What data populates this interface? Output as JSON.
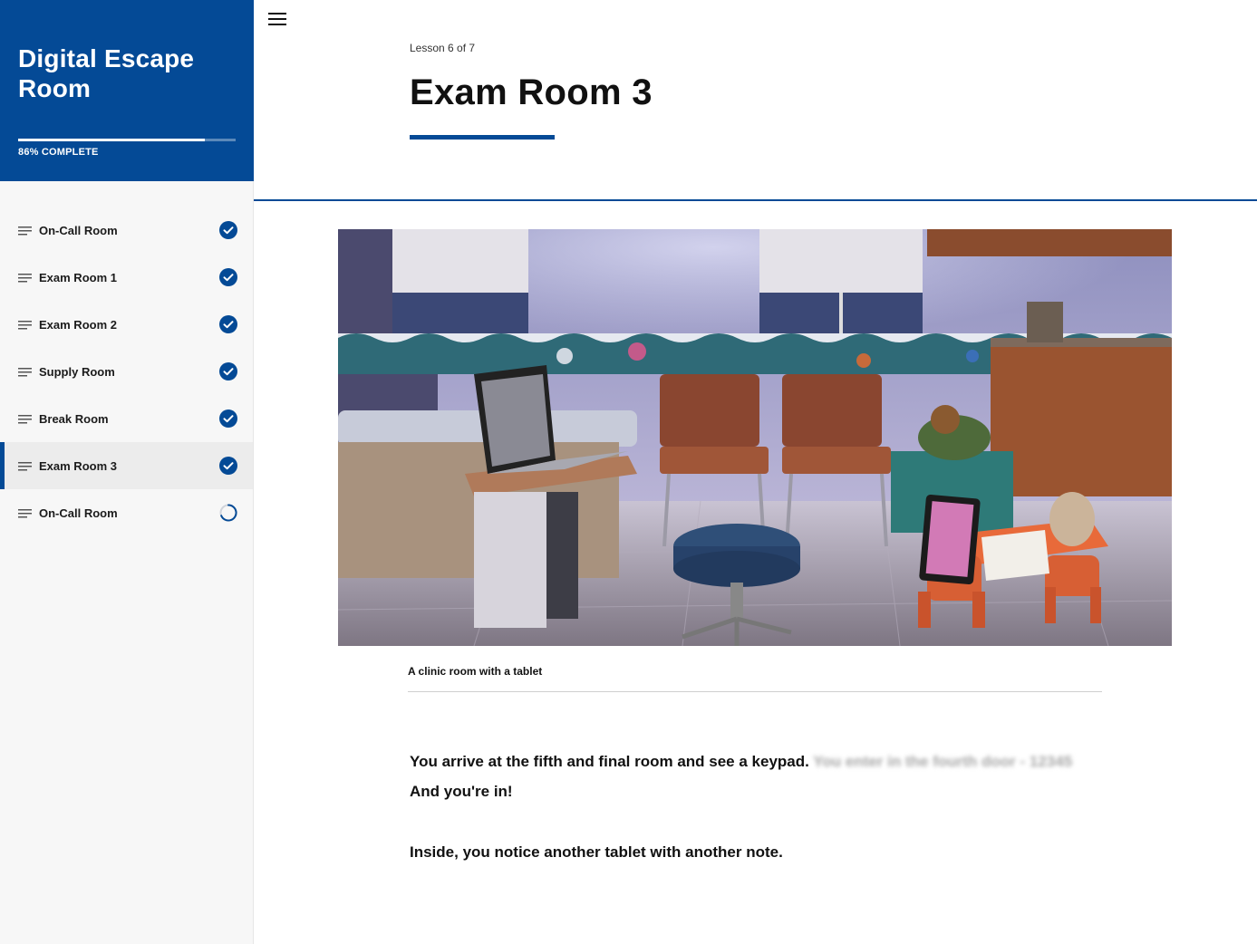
{
  "sidebar": {
    "course_title": "Digital Escape Room",
    "progress_label": "86% COMPLETE",
    "progress_fraction": 0.86,
    "lessons": [
      {
        "label": "On-Call Room",
        "status": "complete",
        "active": false
      },
      {
        "label": "Exam Room 1",
        "status": "complete",
        "active": false
      },
      {
        "label": "Exam Room 2",
        "status": "complete",
        "active": false
      },
      {
        "label": "Supply Room",
        "status": "complete",
        "active": false
      },
      {
        "label": "Break Room",
        "status": "complete",
        "active": false
      },
      {
        "label": "Exam Room 3",
        "status": "complete",
        "active": true
      },
      {
        "label": "On-Call Room",
        "status": "in-progress",
        "active": false
      }
    ]
  },
  "header": {
    "menu_icon": "hamburger-menu-icon",
    "lesson_counter": "Lesson 6 of 7",
    "lesson_title": "Exam Room 3"
  },
  "content": {
    "image_caption": "A clinic room with a tablet",
    "paragraph1": "You arrive at the fifth and final room and see a keypad.",
    "paragraph1_redacted": "You enter in the fourth door - 12345",
    "paragraph1_end": "And you're in!",
    "paragraph2": "Inside, you notice another tablet with another note."
  },
  "colors": {
    "brand_blue": "#044a96",
    "sidebar_bg": "#f7f7f7",
    "active_item_bg": "#ececec"
  }
}
